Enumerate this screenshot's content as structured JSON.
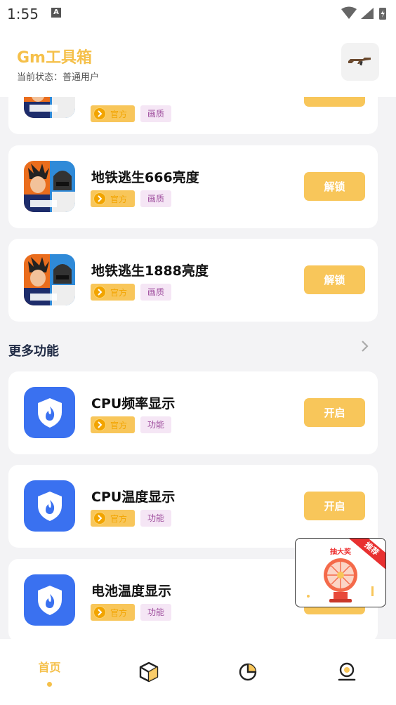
{
  "status_bar": {
    "time": "1:55",
    "notif_letter": "A"
  },
  "header": {
    "title": "Gm工具箱",
    "status": "当前状态：普通用户"
  },
  "cards_top": [
    {
      "title": "",
      "tag1": "官方",
      "tag2": "画质",
      "action": ""
    },
    {
      "title": "地铁逃生666亮度",
      "tag1": "官方",
      "tag2": "画质",
      "action": "解锁"
    },
    {
      "title": "地铁逃生1888亮度",
      "tag1": "官方",
      "tag2": "画质",
      "action": "解锁"
    }
  ],
  "section": {
    "title": "更多功能"
  },
  "features": [
    {
      "title": "CPU频率显示",
      "tag1": "官方",
      "tag2": "功能",
      "action": "开启"
    },
    {
      "title": "CPU温度显示",
      "tag1": "官方",
      "tag2": "功能",
      "action": "开启"
    },
    {
      "title": "电池温度显示",
      "tag1": "官方",
      "tag2": "功能",
      "action": ""
    }
  ],
  "promo": {
    "title": "抽大奖",
    "ribbon": "推荐"
  },
  "bottom_nav": {
    "home": "首页"
  },
  "colors": {
    "accent": "#f8c65a",
    "brand_text": "#f5c04a",
    "shield_blue": "#3a71f0",
    "tag_purple_bg": "#f5e6f5"
  }
}
